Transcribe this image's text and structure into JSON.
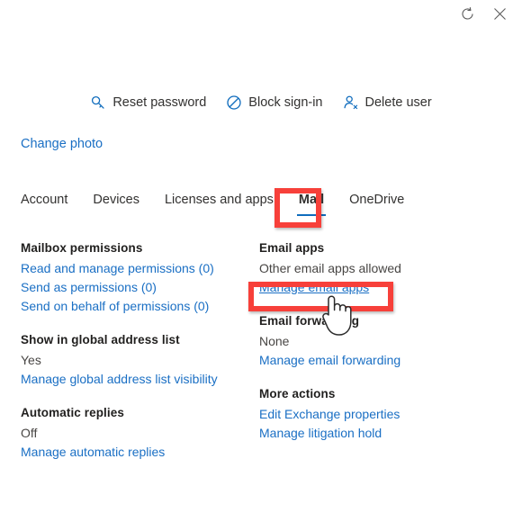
{
  "window": {
    "controls": [
      {
        "name": "refresh-button",
        "icon": "refresh-icon",
        "label": "Refresh"
      },
      {
        "name": "close-button",
        "icon": "close-icon",
        "label": "Close"
      }
    ]
  },
  "command_bar": {
    "items": [
      {
        "icon": "key-icon",
        "label": "Reset password"
      },
      {
        "icon": "block-sign-in-icon",
        "label": "Block sign-in"
      },
      {
        "icon": "delete-user-icon",
        "label": "Delete user"
      }
    ]
  },
  "profile": {
    "change_photo_label": "Change photo"
  },
  "tabs": {
    "items": [
      {
        "label": "Account",
        "selected": false
      },
      {
        "label": "Devices",
        "selected": false
      },
      {
        "label": "Licenses and apps",
        "selected": false
      },
      {
        "label": "Mail",
        "selected": true
      },
      {
        "label": "OneDrive",
        "selected": false
      }
    ],
    "selected": "Mail"
  },
  "mail": {
    "left_column": [
      {
        "title": "Mailbox permissions",
        "value": null,
        "links": [
          "Read and manage permissions (0)",
          "Send as permissions (0)",
          "Send on behalf of permissions (0)"
        ]
      },
      {
        "title": "Show in global address list",
        "value": "Yes",
        "links": [
          "Manage global address list visibility"
        ]
      },
      {
        "title": "Automatic replies",
        "value": "Off",
        "links": [
          "Manage automatic replies"
        ]
      }
    ],
    "right_column": [
      {
        "title": "Email apps",
        "value": "Other email apps allowed",
        "links": [
          "Manage email apps"
        ],
        "hovered_link": "Manage email apps"
      },
      {
        "title": "Email forwarding",
        "value": "None",
        "links": [
          "Manage email forwarding"
        ]
      },
      {
        "title": "More actions",
        "value": null,
        "links": [
          "Edit Exchange properties",
          "Manage litigation hold"
        ]
      }
    ]
  },
  "annotations": {
    "color": "#f7403a",
    "boxes": [
      {
        "name": "mail-tab-highlight",
        "target": "Mail"
      },
      {
        "name": "manage-email-apps-highlight",
        "target": "Manage email apps"
      }
    ]
  },
  "colors": {
    "link": "#1a6fc4",
    "accent": "#0f6cbd",
    "text": "#323130",
    "muted": "#484644",
    "annotation_red": "#f7403a"
  }
}
